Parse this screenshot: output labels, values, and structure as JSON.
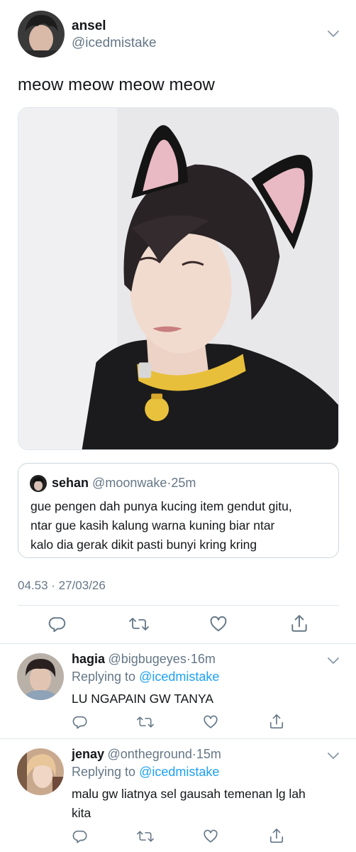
{
  "main_tweet": {
    "display_name": "ansel",
    "handle": "@icedmistake",
    "text": "meow meow meow meow",
    "media_icon": "photo-of-person-with-cat-ears",
    "quote": {
      "display_name": "sehan",
      "handle": "@moonwake",
      "separator": "·",
      "time": "25m",
      "text_lines": [
        "gue pengen dah punya kucing item gendut gitu,",
        "ntar gue kasih kalung warna kuning biar ntar",
        "kalo dia gerak dikit pasti bunyi kring kring"
      ]
    },
    "timestamp": "04.53 · 27/03/26"
  },
  "replies": [
    {
      "display_name": "hagia",
      "handle": "@bigbugeyes",
      "separator": "·",
      "time": "16m",
      "replying_prefix": "Replying to",
      "replying_mention": "@icedmistake",
      "text_lines": [
        "LU NGAPAIN GW TANYA"
      ]
    },
    {
      "display_name": "jenay",
      "handle": "@ontheground",
      "separator": "·",
      "time": "15m",
      "replying_prefix": "Replying to",
      "replying_mention": "@icedmistake",
      "text_lines": [
        "malu gw liatnya sel gausah temenan lg lah",
        "kita"
      ]
    }
  ],
  "colors": {
    "text": "#14171a",
    "secondary": "#657786",
    "accent": "#1da1f2",
    "border": "#e1e8ed"
  },
  "icons": [
    "chevron-down-icon",
    "reply-icon",
    "retweet-icon",
    "like-icon",
    "share-icon"
  ]
}
